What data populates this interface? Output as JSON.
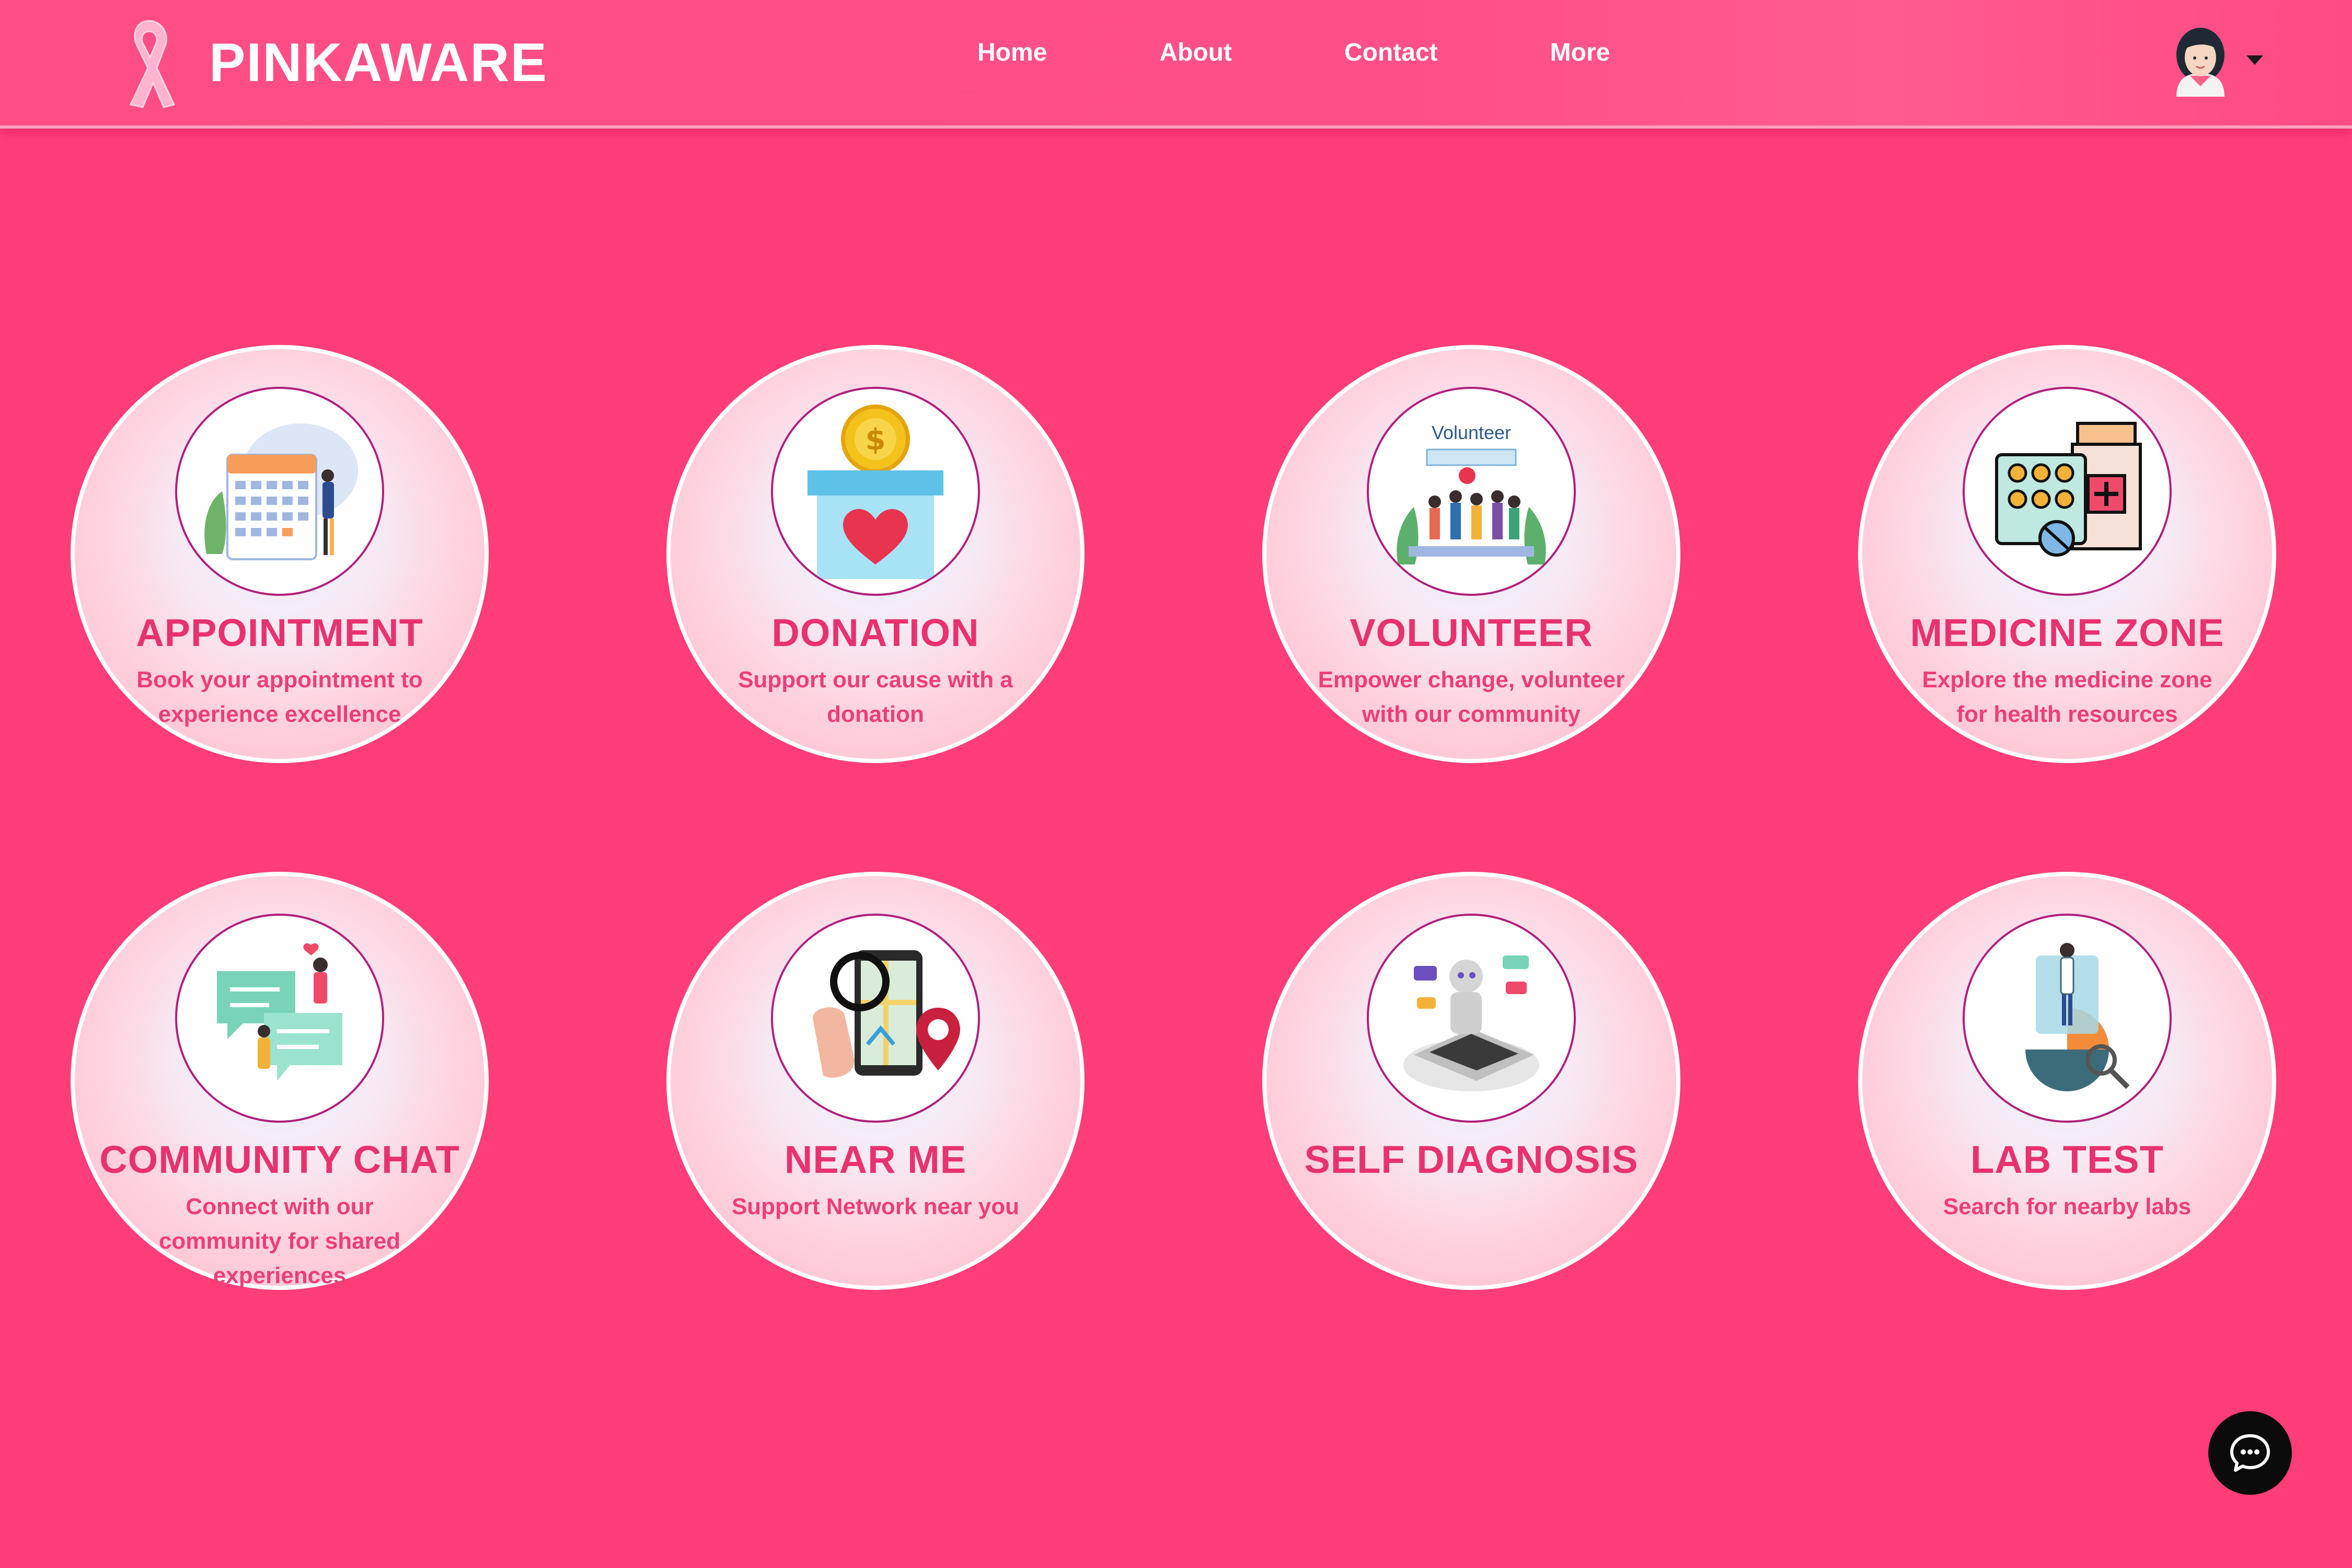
{
  "brand": {
    "name": "PINKAWARE"
  },
  "nav": {
    "items": [
      "Home",
      "About",
      "Contact",
      "More"
    ]
  },
  "cards": [
    {
      "title": "APPOINTMENT",
      "desc": "Book your appointment to experience excellence",
      "icon": "calendar-icon"
    },
    {
      "title": "DONATION",
      "desc": "Support our cause with a donation",
      "icon": "donation-box-icon"
    },
    {
      "title": "VOLUNTEER",
      "desc": "Empower change, volunteer with our community",
      "icon": "volunteer-group-icon",
      "image_text": "Volunteer"
    },
    {
      "title": "MEDICINE ZONE",
      "desc": "Explore the medicine zone for health resources",
      "icon": "medicine-icon"
    },
    {
      "title": "COMMUNITY CHAT",
      "desc": "Connect with our community for shared experiences",
      "icon": "chat-bubbles-icon"
    },
    {
      "title": "NEAR ME",
      "desc": "Support Network near you",
      "icon": "map-pin-phone-icon"
    },
    {
      "title": "SELF DIAGNOSIS",
      "desc": "",
      "icon": "robot-laptop-icon"
    },
    {
      "title": "LAB TEST",
      "desc": "Search for nearby labs",
      "icon": "lab-chart-icon"
    }
  ],
  "colors": {
    "background": "#ff3d78",
    "accent": "#e8326f",
    "ring": "#b0207a"
  }
}
